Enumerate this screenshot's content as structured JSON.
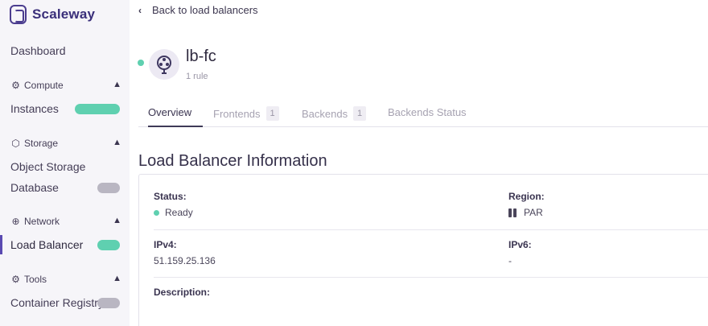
{
  "sidebar": {
    "brand": "Scaleway",
    "dashboard": "Dashboard",
    "sections": {
      "compute": {
        "label": "Compute",
        "items": [
          "Instances"
        ]
      },
      "storage": {
        "label": "Storage",
        "items": [
          "Object Storage",
          "Database"
        ]
      },
      "network": {
        "label": "Network",
        "items": [
          "Load Balancer"
        ]
      },
      "tools": {
        "label": "Tools",
        "items": [
          "Container Registry"
        ]
      }
    },
    "active_item": "Load Balancer"
  },
  "header": {
    "back_label": "Back to load balancers",
    "title": "lb-fc",
    "subtitle": "1 rule"
  },
  "tabs": [
    {
      "label": "Overview",
      "count": ""
    },
    {
      "label": "Frontends",
      "count": "1"
    },
    {
      "label": "Backends",
      "count": "1"
    },
    {
      "label": "Backends Status",
      "count": ""
    }
  ],
  "info": {
    "title": "Load Balancer Information",
    "status_label": "Status:",
    "status_value": "Ready",
    "region_label": "Region:",
    "region_value": "PAR",
    "ipv4_label": "IPv4:",
    "ipv4_value": "51.159.25.136",
    "ipv6_label": "IPv6:",
    "ipv6_value": "-",
    "description_label": "Description:"
  },
  "colors": {
    "brand": "#4b3d8f",
    "status_ready": "#5fd0b0",
    "sidebar_bg": "#f6f5f9"
  }
}
